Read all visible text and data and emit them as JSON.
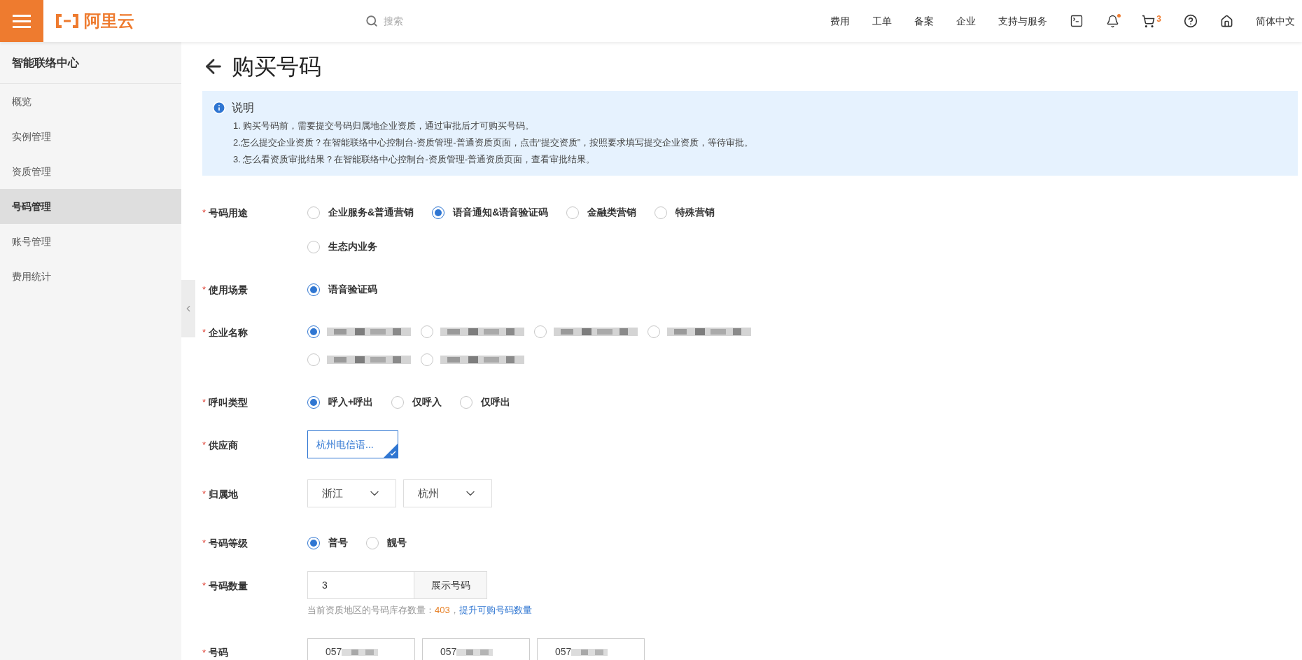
{
  "topbar": {
    "logo": "阿里云",
    "search_placeholder": "搜索",
    "nav": [
      "费用",
      "工单",
      "备案",
      "企业",
      "支持与服务"
    ],
    "cart_count": "3",
    "notification_dot": true,
    "language": "简体中文"
  },
  "sidebar": {
    "title": "智能联络中心",
    "items": [
      {
        "label": "概览",
        "selected": false
      },
      {
        "label": "实例管理",
        "selected": false
      },
      {
        "label": "资质管理",
        "selected": false
      },
      {
        "label": "号码管理",
        "selected": true
      },
      {
        "label": "账号管理",
        "selected": false
      },
      {
        "label": "费用统计",
        "selected": false
      }
    ]
  },
  "page": {
    "title": "购买号码"
  },
  "notice": {
    "title": "说明",
    "lines": [
      "1. 购买号码前，需要提交号码归属地企业资质，通过审批后才可购买号码。",
      "2.怎么提交企业资质？在智能联络中心控制台-资质管理-普通资质页面，点击“提交资质”，按照要求填写提交企业资质，等待审批。",
      "3. 怎么看资质审批结果？在智能联络中心控制台-资质管理-普通资质页面，查看审批结果。"
    ]
  },
  "form": [
    {
      "kind": "radio",
      "label": "号码用途",
      "mark": "*",
      "options": [
        {
          "label": "企业服务&普通营销",
          "selected": false
        },
        {
          "label": "语音通知&语音验证码",
          "selected": true
        },
        {
          "label": "金融类营销",
          "selected": false
        },
        {
          "label": "特殊营销",
          "selected": false
        },
        {
          "label": "生态内业务",
          "selected": false
        }
      ]
    },
    {
      "kind": "radio",
      "label": "使用场景",
      "mark": "*",
      "options": [
        {
          "label": "语音验证码",
          "selected": true
        }
      ]
    },
    {
      "kind": "blurred_radio",
      "label": "企业名称",
      "mark": "*",
      "options": [
        {
          "selected": true
        },
        {
          "selected": false
        },
        {
          "selected": false
        },
        {
          "selected": false
        },
        {
          "selected": false
        },
        {
          "selected": false
        }
      ]
    },
    {
      "kind": "radio",
      "label": "呼叫类型",
      "mark": "*",
      "options": [
        {
          "label": "呼入+呼出",
          "selected": true
        },
        {
          "label": "仅呼入",
          "selected": false
        },
        {
          "label": "仅呼出",
          "selected": false
        }
      ]
    },
    {
      "kind": "card",
      "label": "供应商",
      "mark": "*",
      "options": [
        {
          "label": "杭州电信语...",
          "selected": true
        }
      ]
    },
    {
      "kind": "selects",
      "label": "归属地",
      "mark": "*",
      "values": [
        "浙江",
        "杭州"
      ]
    },
    {
      "kind": "radio",
      "label": "号码等级",
      "mark": "*",
      "options": [
        {
          "label": "普号",
          "selected": true
        },
        {
          "label": "靓号",
          "selected": false
        }
      ]
    },
    {
      "kind": "quantity",
      "label": "号码数量",
      "mark": "*",
      "value": "3",
      "button": "展示号码",
      "hint": "当前资质地区的号码库存数量：",
      "stock": "403",
      "separator": "，",
      "link": "提升可购号码数量"
    },
    {
      "kind": "numbers",
      "label": "号码",
      "mark": "*",
      "values": [
        "057",
        "057",
        "057"
      ]
    }
  ]
}
